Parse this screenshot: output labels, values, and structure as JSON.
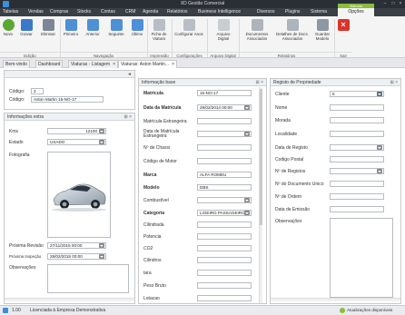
{
  "app": {
    "title": "XD Gestão Comercial"
  },
  "menu": {
    "items": [
      "Tabelas",
      "Vendas",
      "Compras",
      "Stocks",
      "Contas",
      "CRM",
      "Agenda",
      "Relatórios",
      "Business Intelligence",
      "Diversos",
      "Plugins",
      "Sistema"
    ],
    "context_tab": "Viaturas",
    "active": "Opções"
  },
  "ribbon": {
    "buttons": [
      "Novo",
      "Gravar",
      "Eliminar",
      "Primeiro",
      "Anterior",
      "Seguinte",
      "Último",
      "Ficha de Viatura",
      "Configurar Anos",
      "Arquivo Digital",
      "Documentos Associados",
      "Detalhes de Docs. Associados",
      "Guardar Modelo"
    ],
    "groups": [
      "Edição",
      "Navegação",
      "Impressão",
      "Configurações",
      "Arquivo Digital",
      "Relatórios",
      "Sair"
    ]
  },
  "doc_tabs": [
    "Bem-vindo",
    "Dashboard",
    "Viaturas - Listagem",
    "Viaturas: Aston Martin..."
  ],
  "left": {
    "codigo_label": "Código:",
    "codigo_value": "3",
    "codigo2_label": "Código:",
    "codigo2_value": "Aston Martin 15-NO-17",
    "extra_title": "Informações extra",
    "kms_label": "Kms",
    "kms_value": "12100",
    "estado_label": "Estado",
    "estado_value": "USADO",
    "foto_label": "Fotografia",
    "revisao_label": "Próxima Revisão",
    "revisao_value": "27/11/2015 00:00",
    "inspecao_label": "Próxima Inspeção",
    "inspecao_value": "28/02/2018 00:00",
    "obs_label": "Observações"
  },
  "mid": {
    "title": "Informação base",
    "matricula_label": "Matrícula",
    "matricula_value": "15-NO-17",
    "data_mat_label": "Data da Matrícula",
    "data_mat_value": "28/02/2014 00:00",
    "mat_est_label": "Matrícula Estrangeira",
    "data_mat_est_label": "Data de Matrícula Estrangeira",
    "chassi_label": "Nº de Chassi",
    "motor_label": "Código de Motor",
    "marca_label": "Marca",
    "marca_value": "ALFA ROMEU",
    "modelo_label": "Modelo",
    "modelo_value": "DBS",
    "combustivel_label": "Combustível",
    "categoria_label": "Categoria",
    "categoria_value": "LIGEIRO PASSAGEIROS",
    "cilindrada_label": "Cilindrada",
    "potencia_label": "Potencia",
    "co2_label": "CO2",
    "cilindros_label": "Cilindros",
    "tara_label": "tara",
    "peso_label": "Peso Bruto",
    "lotacao_label": "Lotacao"
  },
  "right": {
    "title": "Registo de Propriedade",
    "cliente_label": "Cliente",
    "cliente_value": "6",
    "nome_label": "Nome",
    "morada_label": "Morada",
    "localidade_label": "Localidade",
    "data_reg_label": "Data de Registo",
    "cod_postal_label": "Codigo Postal",
    "n_reg_label": "Nº de Registos",
    "n_doc_label": "Nº do Documento Unico",
    "n_ordem_label": "Nº de Ordem",
    "data_emissao_label": "Data de Emissão",
    "obs_label": "Observações"
  },
  "status": {
    "version": "1.00",
    "license": "Licenciada à Empresa Demonstrativa",
    "updates": "Atualizações disponíveis"
  },
  "colors": {
    "accent_green": "#8cbc3a",
    "dark_bar": "#2a2f36"
  }
}
